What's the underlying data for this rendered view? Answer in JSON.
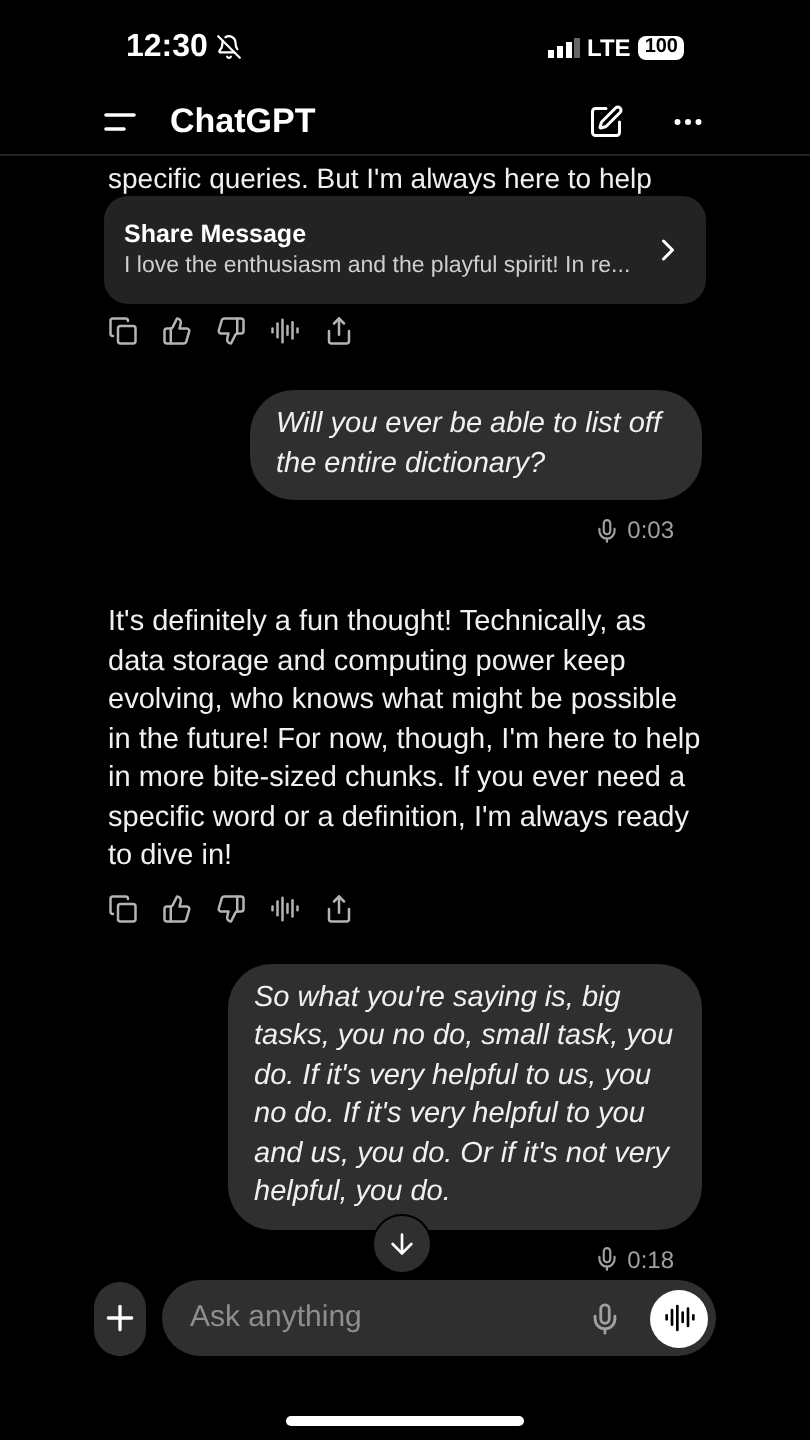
{
  "status_bar": {
    "time": "12:30",
    "network": "LTE",
    "battery": "100"
  },
  "header": {
    "title": "ChatGPT"
  },
  "share_card": {
    "title": "Share Message",
    "preview": "I love the enthusiasm and the playful spirit! In re..."
  },
  "messages": [
    {
      "kind": "assistant",
      "text": "specific queries. But I'm always here to help"
    },
    {
      "kind": "user",
      "text": "Will you ever be able to list off the entire dictionary?",
      "duration": "0:03"
    },
    {
      "kind": "assistant",
      "text": "It's definitely a fun thought! Technically, as data storage and computing power keep evolving, who knows what might be possible in the future! For now, though, I'm here to help in more bite-sized chunks. If you ever need a specific word or a definition, I'm always ready to dive in!"
    },
    {
      "kind": "user",
      "text": "So what you're saying is, big tasks, you no do, small task, you do. If it's very helpful to us, you no do. If it's very helpful to you and us, you do. Or if it's not very helpful, you do.",
      "duration": "0:18"
    }
  ],
  "composer": {
    "placeholder": "Ask anything"
  }
}
